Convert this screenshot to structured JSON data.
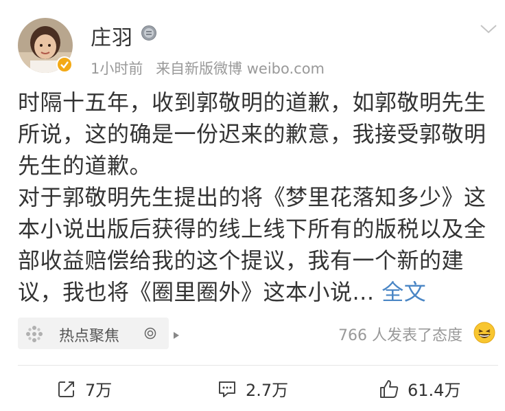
{
  "post": {
    "author": "庄羽",
    "time": "1小时前",
    "source": "来自新版微博 weibo.com",
    "paragraphs": [
      "时隔十五年，收到郭敬明的道歉，如郭敬明先生所说，这的确是一份迟来的歉意，我接受郭敬明先生的道歉。",
      "对于郭敬明先生提出的将《梦里花落知多少》这本小说出版后获得的线上线下所有的版税以及全部收益赔偿给我的这个提议，我有一个新的建议，我也将《圈里圈外》这本小说..."
    ],
    "more_label": "全文"
  },
  "topic": {
    "label": "热点聚焦"
  },
  "attitude": {
    "text": "766 人发表了态度"
  },
  "actions": {
    "repost": "7万",
    "comment": "2.7万",
    "like": "61.4万"
  },
  "icons": {
    "verify": "verified-badge-icon",
    "medal": "medal-icon",
    "chevron": "chevron-down-icon",
    "topic": "pinwheel-icon",
    "repost": "repost-icon",
    "comment": "comment-icon",
    "like": "thumbs-up-icon"
  },
  "colors": {
    "link": "#4a86c5",
    "verify": "#f3a916",
    "text": "#333333",
    "meta": "#999999"
  }
}
